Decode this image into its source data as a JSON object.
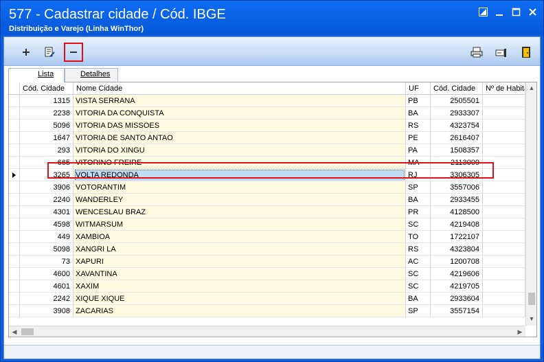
{
  "window": {
    "title": "577 - Cadastrar cidade / Cód. IBGE",
    "subtitle": "Distribuição e Varejo (Linha WinThor)"
  },
  "tabs": {
    "lista": "Lista",
    "detalhes": "Detalhes"
  },
  "grid": {
    "headers": {
      "cod": "Cód. Cidade",
      "nome": "Nome Cidade",
      "uf": "UF",
      "ibge": "Cód. Cidade",
      "hab": "Nº de Habita"
    },
    "rows": [
      {
        "cod": "1315",
        "nome": "VISTA SERRANA",
        "uf": "PB",
        "ibge": "2505501"
      },
      {
        "cod": "2238",
        "nome": "VITORIA DA CONQUISTA",
        "uf": "BA",
        "ibge": "2933307"
      },
      {
        "cod": "5096",
        "nome": "VITORIA DAS MISSOES",
        "uf": "RS",
        "ibge": "4323754"
      },
      {
        "cod": "1647",
        "nome": "VITORIA DE SANTO ANTAO",
        "uf": "PE",
        "ibge": "2616407"
      },
      {
        "cod": "293",
        "nome": "VITORIA DO XINGU",
        "uf": "PA",
        "ibge": "1508357"
      },
      {
        "cod": "665",
        "nome": "VITORINO FREIRE",
        "uf": "MA",
        "ibge": "2113009"
      },
      {
        "cod": "3265",
        "nome": "VOLTA REDONDA",
        "uf": "RJ",
        "ibge": "3306305"
      },
      {
        "cod": "3906",
        "nome": "VOTORANTIM",
        "uf": "SP",
        "ibge": "3557006"
      },
      {
        "cod": "2240",
        "nome": "WANDERLEY",
        "uf": "BA",
        "ibge": "2933455"
      },
      {
        "cod": "4301",
        "nome": "WENCESLAU BRAZ",
        "uf": "PR",
        "ibge": "4128500"
      },
      {
        "cod": "4598",
        "nome": "WITMARSUM",
        "uf": "SC",
        "ibge": "4219408"
      },
      {
        "cod": "449",
        "nome": "XAMBIOA",
        "uf": "TO",
        "ibge": "1722107"
      },
      {
        "cod": "5098",
        "nome": "XANGRI LA",
        "uf": "RS",
        "ibge": "4323804"
      },
      {
        "cod": "73",
        "nome": "XAPURI",
        "uf": "AC",
        "ibge": "1200708"
      },
      {
        "cod": "4600",
        "nome": "XAVANTINA",
        "uf": "SC",
        "ibge": "4219606"
      },
      {
        "cod": "4601",
        "nome": "XAXIM",
        "uf": "SC",
        "ibge": "4219705"
      },
      {
        "cod": "2242",
        "nome": "XIQUE XIQUE",
        "uf": "BA",
        "ibge": "2933604"
      },
      {
        "cod": "3908",
        "nome": "ZACARIAS",
        "uf": "SP",
        "ibge": "3557154"
      }
    ],
    "selected_index": 6
  },
  "colors": {
    "titlebar": "#0656d8",
    "highlight": "#e0101a",
    "name_column_bg": "#fffbe0",
    "selection_bg": "#c0dcf3"
  },
  "icons": {
    "add": "plus-icon",
    "edit": "edit-document-icon",
    "delete": "minus-icon",
    "print": "printer-icon",
    "select": "pointer-hand-icon",
    "exit": "exit-door-icon"
  }
}
